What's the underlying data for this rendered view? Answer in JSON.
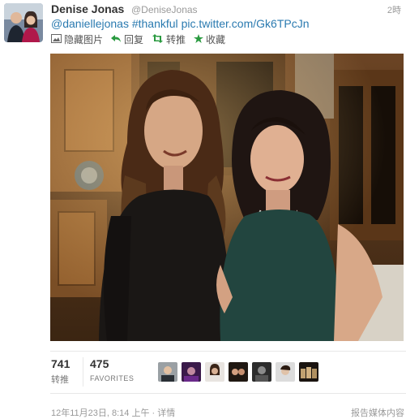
{
  "tweet": {
    "author_name": "Denise Jonas",
    "author_handle": "@DeniseJonas",
    "time": "2時",
    "mention": "@daniellejonas",
    "hashtag": "#thankful",
    "link": "pic.twitter.com/Gk6TPcJn"
  },
  "actions": {
    "hide_media": "隐藏图片",
    "reply": "回复",
    "retweet": "转推",
    "favorite": "收藏"
  },
  "stats": {
    "retweets_count": "741",
    "retweets_label": "转推",
    "favorites_count": "475",
    "favorites_label": "FAVORITES"
  },
  "footer": {
    "date": "12年11月23日, 8:14 上午",
    "separator": "·",
    "details": "详情",
    "report": "报告媒体内容"
  },
  "icons": {
    "hide_media": "photo-icon",
    "reply": "reply-arrow-icon",
    "retweet": "retweet-icon",
    "favorite": "star-icon"
  },
  "colors": {
    "link": "#2a7ab0",
    "muted": "#999999",
    "text": "#333333"
  }
}
